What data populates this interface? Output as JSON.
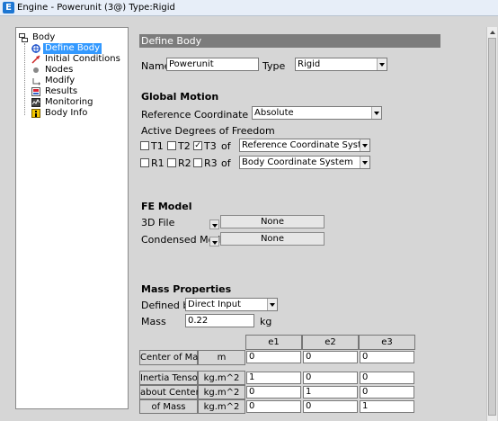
{
  "window": {
    "title": "Engine - Powerunit (3@)   Type:Rigid"
  },
  "tree": {
    "root": "Body",
    "items": [
      {
        "label": "Define Body",
        "icon": "define-body-icon",
        "selected": true
      },
      {
        "label": "Initial Conditions",
        "icon": "initial-conditions-icon"
      },
      {
        "label": "Nodes",
        "icon": "nodes-icon"
      },
      {
        "label": "Modify",
        "icon": "modify-icon"
      },
      {
        "label": "Results",
        "icon": "results-icon"
      },
      {
        "label": "Monitoring",
        "icon": "monitoring-icon"
      },
      {
        "label": "Body Info",
        "icon": "info-icon"
      }
    ]
  },
  "panel": {
    "header": "Define Body",
    "name_label": "Name",
    "name_value": "Powerunit",
    "type_label": "Type",
    "type_value": "Rigid"
  },
  "global_motion": {
    "title": "Global Motion",
    "ref_label": "Reference Coordinate System",
    "ref_value": "Absolute",
    "dof_label": "Active Degrees of Freedom",
    "translations": [
      {
        "label": "T1",
        "checked": false
      },
      {
        "label": "T2",
        "checked": false
      },
      {
        "label": "T3",
        "checked": true
      }
    ],
    "rotations": [
      {
        "label": "R1",
        "checked": false
      },
      {
        "label": "R2",
        "checked": false
      },
      {
        "label": "R3",
        "checked": false
      }
    ],
    "of_label": "of",
    "t_system": "Reference Coordinate System",
    "r_system": "Body Coordinate System"
  },
  "fe_model": {
    "title": "FE Model",
    "file_label": "3D File",
    "file_value": "None",
    "condensed_label": "Condensed Model",
    "condensed_value": "None"
  },
  "mass": {
    "title": "Mass Properties",
    "defined_label": "Defined by",
    "defined_value": "Direct Input",
    "mass_label": "Mass",
    "mass_value": "0.22",
    "mass_unit": "kg",
    "columns": [
      "e1",
      "e2",
      "e3"
    ],
    "com_label": "Center of Mass",
    "com_unit": "m",
    "com_values": [
      "0",
      "0",
      "0"
    ],
    "inertia_labels": [
      "Inertia Tensor",
      "about Center",
      "of Mass"
    ],
    "inertia_unit": "kg.m^2",
    "inertia_rows": [
      [
        "1",
        "0",
        "0"
      ],
      [
        "0",
        "1",
        "0"
      ],
      [
        "0",
        "0",
        "1"
      ]
    ]
  }
}
